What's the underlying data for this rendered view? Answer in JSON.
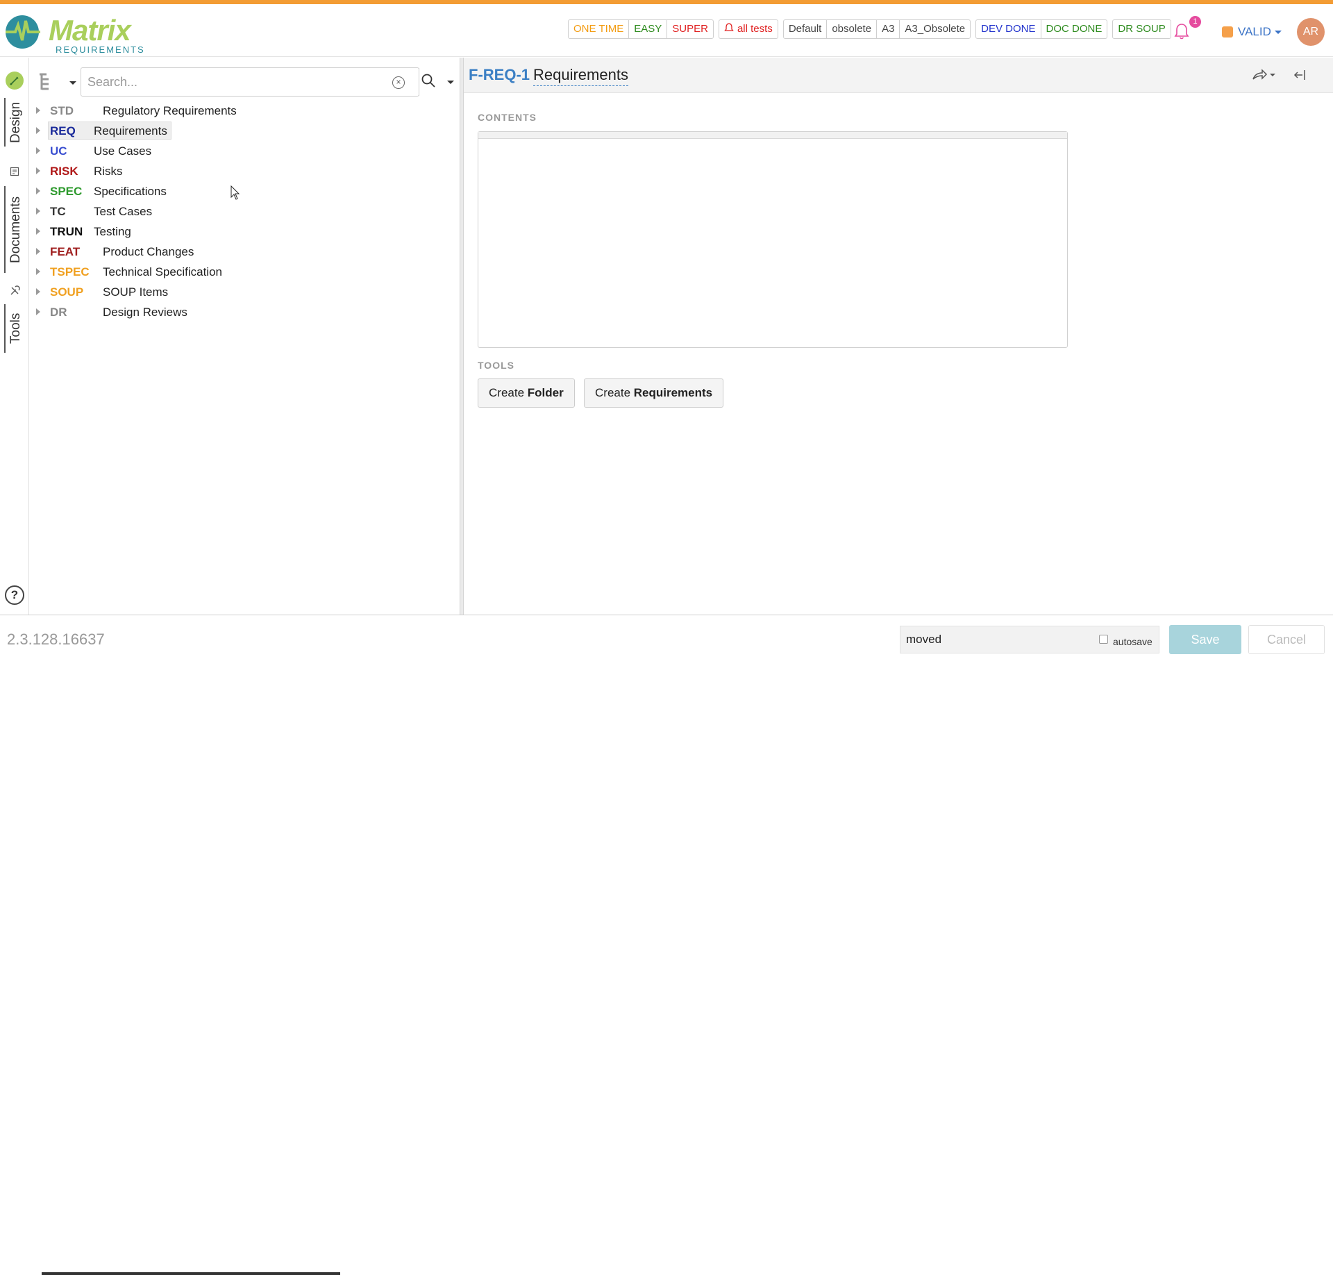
{
  "header": {
    "logo": {
      "name": "Matrix",
      "sub": "REQUIREMENTS"
    },
    "label_groups": [
      [
        {
          "text": "ONE TIME",
          "color": "#f39c12"
        },
        {
          "text": "EASY",
          "color": "#2e8b1e"
        },
        {
          "text": "SUPER",
          "color": "#e02020"
        }
      ],
      [
        {
          "text": "all tests",
          "color": "#e02020",
          "icon": "bell-outline-icon"
        }
      ],
      [
        {
          "text": "Default",
          "color": "#444444"
        },
        {
          "text": "obsolete",
          "color": "#444444"
        },
        {
          "text": "A3",
          "color": "#444444"
        },
        {
          "text": "A3_Obsolete",
          "color": "#444444"
        }
      ],
      [
        {
          "text": "DEV DONE",
          "color": "#2233cc"
        },
        {
          "text": "DOC DONE",
          "color": "#2e8b1e"
        }
      ],
      [
        {
          "text": "DR SOUP",
          "color": "#2e8b1e"
        }
      ]
    ],
    "notifications_count": "1",
    "status": "VALID",
    "avatar_initials": "AR"
  },
  "leftnav": {
    "tabs": [
      "Design",
      "Documents",
      "Tools"
    ],
    "help": "?"
  },
  "tree": {
    "search_placeholder": "Search...",
    "items": [
      {
        "code": "STD",
        "label": "Regulatory Requirements",
        "color": "#888888"
      },
      {
        "code": "REQ",
        "label": "Requirements",
        "color": "#1a2a9a"
      },
      {
        "code": "UC",
        "label": "Use Cases",
        "color": "#3a4fd0"
      },
      {
        "code": "RISK",
        "label": "Risks",
        "color": "#b01818"
      },
      {
        "code": "SPEC",
        "label": "Specifications",
        "color": "#2e9a2e"
      },
      {
        "code": "TC",
        "label": "Test Cases",
        "color": "#333333"
      },
      {
        "code": "TRUN",
        "label": "Testing",
        "color": "#111111"
      },
      {
        "code": "FEAT",
        "label": "Product Changes",
        "color": "#a02020"
      },
      {
        "code": "TSPEC",
        "label": "Technical Specification",
        "color": "#f0a020"
      },
      {
        "code": "SOUP",
        "label": "SOUP Items",
        "color": "#f0a020"
      },
      {
        "code": "DR",
        "label": "Design Reviews",
        "color": "#888888"
      }
    ],
    "selected_index": 1
  },
  "content": {
    "item_id": "F-REQ-1",
    "item_title": "Requirements",
    "contents_heading": "CONTENTS",
    "tools_heading": "TOOLS",
    "tool_buttons": [
      {
        "prefix": "Create ",
        "bold": "Folder"
      },
      {
        "prefix": "Create ",
        "bold": "Requirements"
      }
    ]
  },
  "footer": {
    "version": "2.3.128.16637",
    "comment_value": "moved",
    "autosave_label": "autosave",
    "save_label": "Save",
    "cancel_label": "Cancel"
  }
}
